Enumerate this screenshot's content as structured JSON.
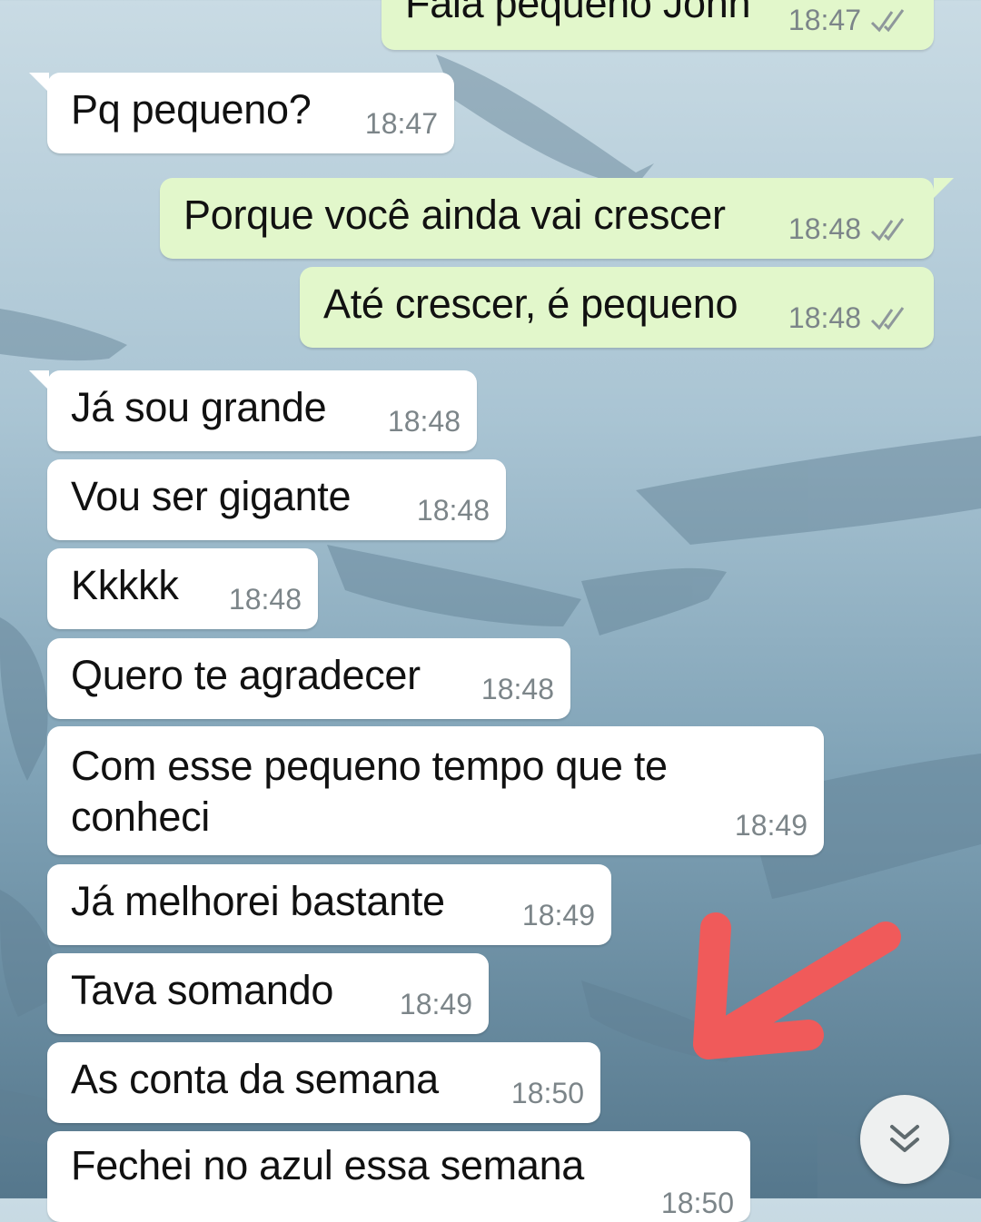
{
  "chat": {
    "messages": [
      {
        "dir": "out",
        "text": "Fala pequeno John",
        "time": "18:47"
      },
      {
        "dir": "in",
        "text": "Pq pequeno?",
        "time": "18:47"
      },
      {
        "dir": "out",
        "text": "Porque você ainda vai crescer",
        "time": "18:48"
      },
      {
        "dir": "out",
        "text": "Até crescer, é pequeno",
        "time": "18:48"
      },
      {
        "dir": "in",
        "text": "Já sou grande",
        "time": "18:48"
      },
      {
        "dir": "in",
        "text": "Vou ser gigante",
        "time": "18:48"
      },
      {
        "dir": "in",
        "text": "Kkkkk",
        "time": "18:48"
      },
      {
        "dir": "in",
        "text": "Quero te agradecer",
        "time": "18:48"
      },
      {
        "dir": "in",
        "text": "Com esse pequeno tempo que te conheci",
        "time": "18:49"
      },
      {
        "dir": "in",
        "text": "Já melhorei bastante",
        "time": "18:49"
      },
      {
        "dir": "in",
        "text": "Tava somando",
        "time": "18:49"
      },
      {
        "dir": "in",
        "text": "As conta da semana",
        "time": "18:50"
      },
      {
        "dir": "in",
        "text": "Fechei no azul essa semana",
        "time": "18:50"
      }
    ]
  },
  "colors": {
    "incoming_bubble": "#ffffff",
    "outgoing_bubble": "#e2f7cb",
    "timestamp": "#7c8589",
    "annotation_arrow": "#f05a5a"
  },
  "icons": {
    "read_receipt": "double-check-icon",
    "scroll_down": "chevron-double-down-icon",
    "annotation": "red-arrow-annotation"
  }
}
